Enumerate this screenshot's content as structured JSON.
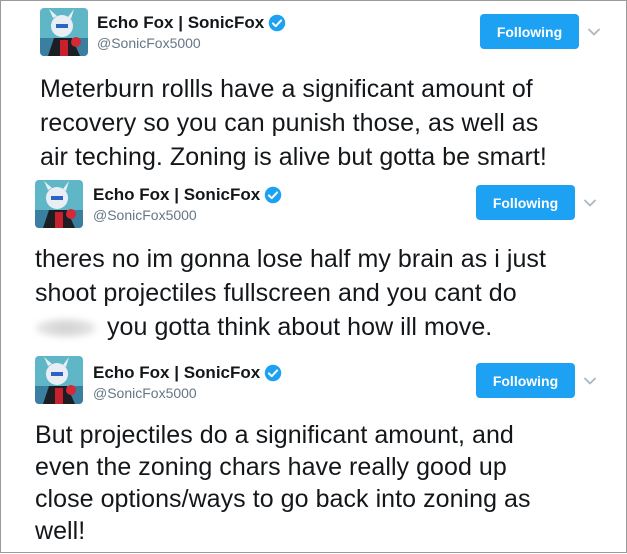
{
  "tweets": [
    {
      "author": {
        "name": "Echo Fox | SonicFox",
        "handle": "@SonicFox5000",
        "avatar_icon": "sonicfox-avatar-icon",
        "verified_icon": "verified-badge-icon"
      },
      "follow_label": "Following",
      "text_lines": [
        "Meterburn rollls have a significant amount of",
        "recovery so you can punish those, as well as",
        "air teching. Zoning is alive but gotta be smart!"
      ]
    },
    {
      "author": {
        "name": "Echo Fox | SonicFox",
        "handle": "@SonicFox5000",
        "avatar_icon": "sonicfox-avatar-icon",
        "verified_icon": "verified-badge-icon"
      },
      "follow_label": "Following",
      "text_lines": [
        "theres no im gonna lose half my brain as i just",
        "shoot projectiles fullscreen and you cant do",
        "you gotta think about how ill move."
      ]
    },
    {
      "author": {
        "name": "Echo Fox | SonicFox",
        "handle": "@SonicFox5000",
        "avatar_icon": "sonicfox-avatar-icon",
        "verified_icon": "verified-badge-icon"
      },
      "follow_label": "Following",
      "text_lines": [
        "But projectiles do a significant amount, and",
        "even the zoning chars have really good up",
        "close options/ways to go back into zoning as",
        "well!"
      ]
    }
  ],
  "colors": {
    "accent": "#1da1f2",
    "text": "#14171a",
    "muted": "#657786",
    "border": "#9a9a9a"
  }
}
